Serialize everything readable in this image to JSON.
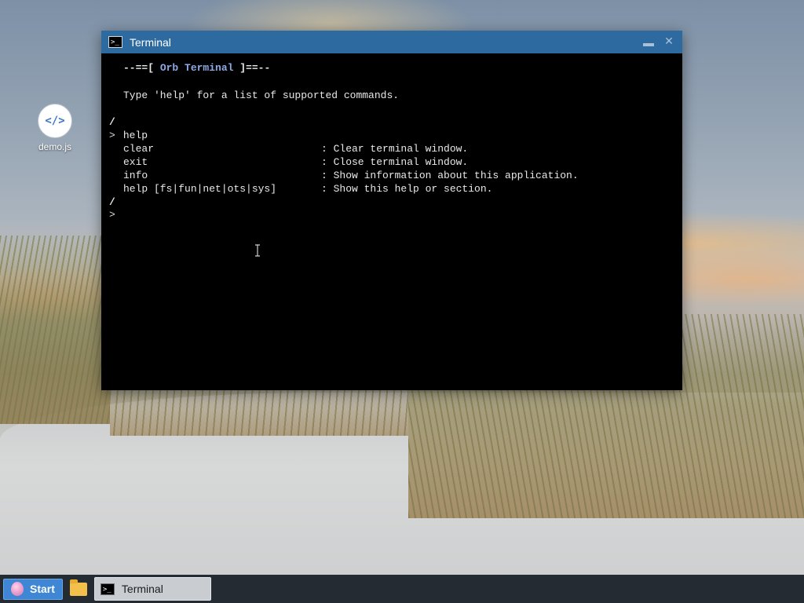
{
  "desktop": {
    "icon": {
      "symbol": "</>",
      "label": "demo.js",
      "icon_name": "code-file-icon"
    }
  },
  "window": {
    "title": "Terminal",
    "app_icon_symbol": ">_",
    "minimize_label": "minimize",
    "close_symbol": "✕"
  },
  "terminal": {
    "banner": {
      "left": "--==[ ",
      "name": "Orb Terminal",
      "right": " ]==--"
    },
    "welcome": "Type 'help' for a list of supported commands.",
    "slash": "/",
    "prompt_symbol": ">",
    "entered_command": "help",
    "help_rows": [
      {
        "command": "clear",
        "description": ": Clear terminal window."
      },
      {
        "command": "exit",
        "description": ": Close terminal window."
      },
      {
        "command": "info",
        "description": ": Show information about this application."
      },
      {
        "command": "help [fs|fun|net|ots|sys]",
        "description": ": Show this help or section."
      }
    ]
  },
  "taskbar": {
    "start_label": "Start",
    "folder_icon": "folder-icon",
    "task_label": "Terminal",
    "task_icon_symbol": ">_"
  },
  "colors": {
    "titlebar": "#2c6aa0",
    "taskbar": "#252b33",
    "start_button": "#3f87d4",
    "banner_name": "#8ea9e6"
  }
}
